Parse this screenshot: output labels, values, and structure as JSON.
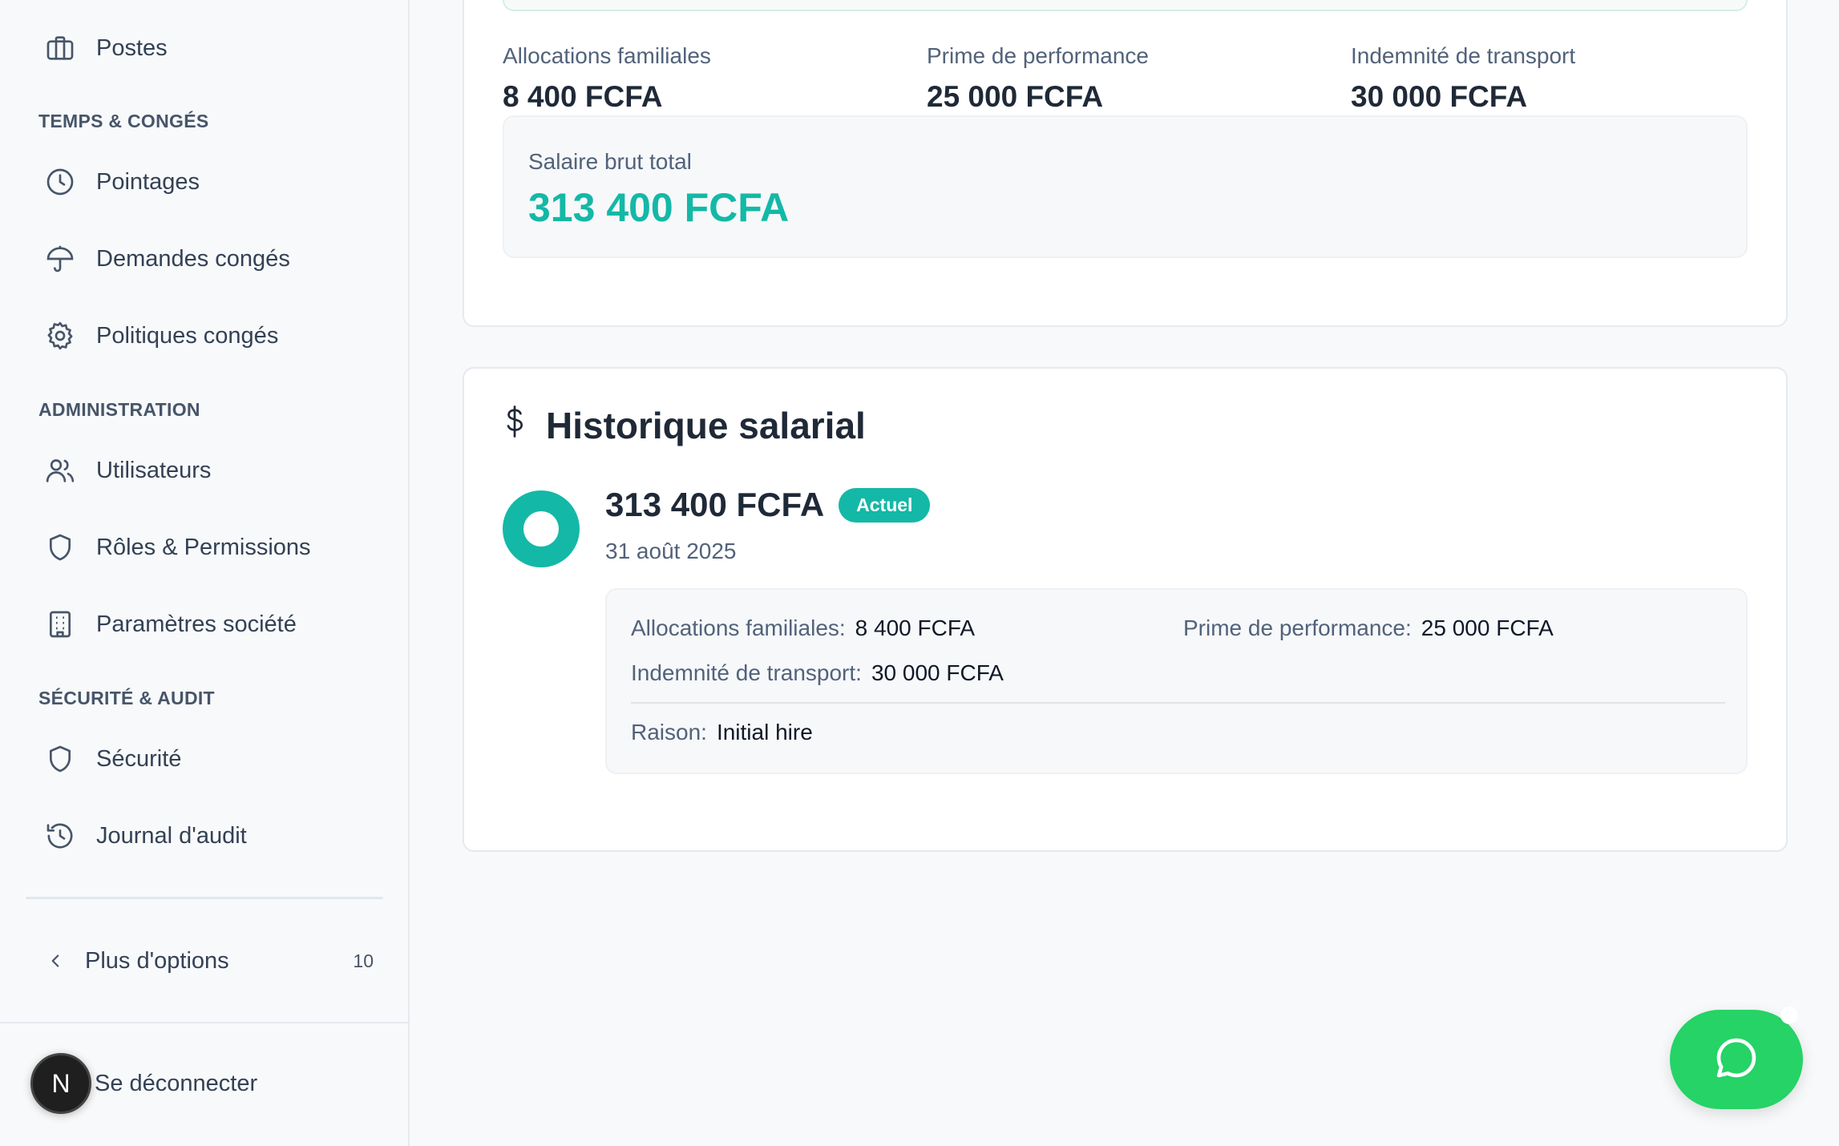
{
  "sidebar": {
    "top_item": {
      "label": "Postes",
      "icon": "briefcase-icon"
    },
    "sections": [
      {
        "title": "TEMPS & CONGÉS",
        "items": [
          {
            "label": "Pointages",
            "icon": "clock-icon"
          },
          {
            "label": "Demandes congés",
            "icon": "umbrella-icon"
          },
          {
            "label": "Politiques congés",
            "icon": "gear-icon"
          }
        ]
      },
      {
        "title": "ADMINISTRATION",
        "items": [
          {
            "label": "Utilisateurs",
            "icon": "users-icon"
          },
          {
            "label": "Rôles & Permissions",
            "icon": "shield-icon"
          },
          {
            "label": "Paramètres société",
            "icon": "building-icon"
          }
        ]
      },
      {
        "title": "SÉCURITÉ & AUDIT",
        "items": [
          {
            "label": "Sécurité",
            "icon": "shield-icon"
          },
          {
            "label": "Journal d'audit",
            "icon": "history-icon"
          }
        ]
      }
    ],
    "more_options": {
      "label": "Plus d'options",
      "count": "10"
    },
    "logout": {
      "label": "Se déconnecter",
      "avatar_letter": "N"
    }
  },
  "salary_summary": {
    "stats": [
      {
        "label": "Allocations familiales",
        "value": "8 400 FCFA"
      },
      {
        "label": "Prime de performance",
        "value": "25 000 FCFA"
      },
      {
        "label": "Indemnité de transport",
        "value": "30 000 FCFA"
      }
    ],
    "gross": {
      "label": "Salaire brut total",
      "value": "313 400 FCFA"
    }
  },
  "history": {
    "title": "Historique salarial",
    "entry": {
      "amount": "313 400 FCFA",
      "badge": "Actuel",
      "date": "31 août 2025",
      "details": [
        {
          "key": "Allocations familiales:",
          "value": "8 400 FCFA"
        },
        {
          "key": "Prime de performance:",
          "value": "25 000 FCFA"
        },
        {
          "key": "Indemnité de transport:",
          "value": "30 000 FCFA"
        }
      ],
      "reason": {
        "key": "Raison:",
        "value": "Initial hire"
      }
    }
  },
  "colors": {
    "accent": "#14b8a6",
    "chat": "#25d366"
  }
}
